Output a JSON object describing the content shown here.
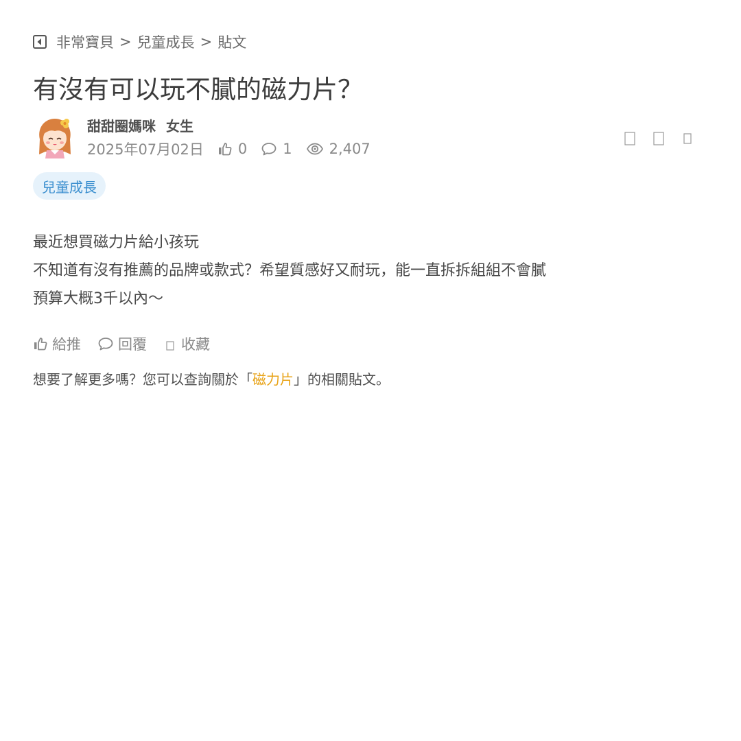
{
  "breadcrumb": {
    "items": [
      "非常寶貝",
      "兒童成長",
      "貼文"
    ],
    "separator": ">"
  },
  "post": {
    "title": "有沒有可以玩不膩的磁力片？",
    "author": {
      "name": "甜甜圈媽咪",
      "gender": "女生"
    },
    "date": "2025年07月02日",
    "likes": "0",
    "replies": "1",
    "views": "2,407",
    "tag": "兒童成長",
    "content": [
      "最近想買磁力片給小孩玩",
      "不知道有沒有推薦的品牌或款式？希望質感好又耐玩，能一直拆拆組組不會膩",
      "預算大概3千以內～"
    ]
  },
  "actions": {
    "like_label": "給推",
    "reply_label": "回覆",
    "bookmark_label": "收藏"
  },
  "related": {
    "prefix": "想要了解更多嗎？您可以查詢關於「",
    "keyword": "磁力片",
    "suffix": "」的相關貼文。"
  },
  "colors": {
    "tag_bg": "#e6f2fb",
    "tag_text": "#3b8fcf",
    "keyword": "#e8a317",
    "meta_text": "#8a8a8a"
  },
  "icons": [
    "back-icon",
    "avatar",
    "thumbs-up-icon",
    "comment-icon",
    "eye-icon",
    "share-icon",
    "bookmark-icon",
    "more-icon"
  ]
}
